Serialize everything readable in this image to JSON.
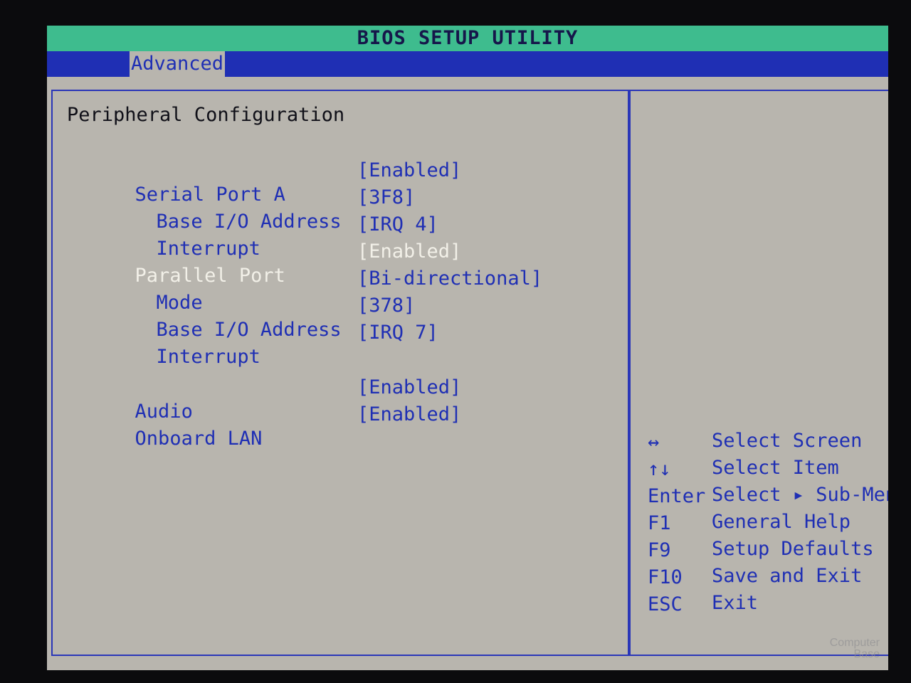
{
  "title": "BIOS SETUP UTILITY",
  "menu": {
    "active_tab": "Advanced"
  },
  "section_title": "Peripheral Configuration",
  "settings": [
    {
      "label": "Serial Port A",
      "value": "[Enabled]",
      "indent": false,
      "selected": false
    },
    {
      "label": "Base I/O Address",
      "value": "[3F8]",
      "indent": true,
      "selected": false
    },
    {
      "label": "Interrupt",
      "value": "[IRQ 4]",
      "indent": true,
      "selected": false
    },
    {
      "label": "Parallel Port",
      "value": "[Enabled]",
      "indent": false,
      "selected": true
    },
    {
      "label": "Mode",
      "value": "[Bi-directional]",
      "indent": true,
      "selected": false
    },
    {
      "label": "Base I/O Address",
      "value": "[378]",
      "indent": true,
      "selected": false
    },
    {
      "label": "Interrupt",
      "value": "[IRQ 7]",
      "indent": true,
      "selected": false
    },
    {
      "label": "Audio",
      "value": "[Enabled]",
      "indent": false,
      "selected": false
    },
    {
      "label": "Onboard LAN",
      "value": "[Enabled]",
      "indent": false,
      "selected": false
    }
  ],
  "help": [
    {
      "key": "↔",
      "desc": "Select Screen"
    },
    {
      "key": "↑↓",
      "desc": "Select Item"
    },
    {
      "key": "Enter",
      "desc": "Select ▸ Sub-Menu"
    },
    {
      "key": "F1",
      "desc": "General Help"
    },
    {
      "key": "F9",
      "desc": "Setup Defaults"
    },
    {
      "key": "F10",
      "desc": "Save and Exit"
    },
    {
      "key": "ESC",
      "desc": "Exit"
    }
  ],
  "watermark": {
    "line1": "Computer",
    "line2": "Base"
  },
  "colors": {
    "title_bg": "#3ebc8e",
    "menu_bg": "#1f2fb4",
    "panel_bg": "#b8b5ae",
    "text_blue": "#1f2fb4",
    "highlight": "#f2f0e8"
  }
}
